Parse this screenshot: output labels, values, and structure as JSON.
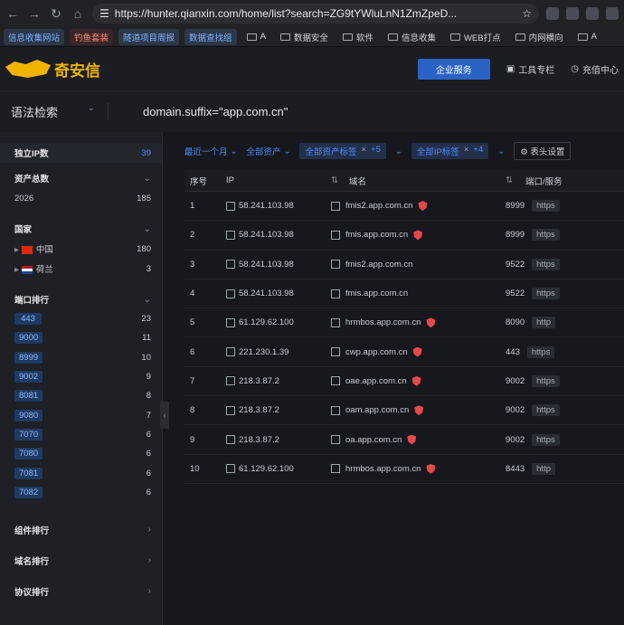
{
  "browser": {
    "url": "https://hunter.qianxin.com/home/list?search=ZG9tYWluLnN1ZmZpeD...",
    "bookmarks": [
      {
        "label": "信息收集网站",
        "style": "colored"
      },
      {
        "label": "钓鱼套装",
        "style": "red"
      },
      {
        "label": "隧道项目周报",
        "style": "colored"
      },
      {
        "label": "数据查找组",
        "style": "colored"
      },
      {
        "label": "A",
        "style": "folder"
      },
      {
        "label": "数据安全",
        "style": "folder"
      },
      {
        "label": "软件",
        "style": "folder"
      },
      {
        "label": "信息收集",
        "style": "folder"
      },
      {
        "label": "WEB打点",
        "style": "folder"
      },
      {
        "label": "内网横向",
        "style": "folder"
      },
      {
        "label": "A",
        "style": "folder"
      }
    ]
  },
  "header": {
    "logo_text": "奇安信",
    "enterprise": "企业服务",
    "tools": "工具专栏",
    "recharge": "充值中心"
  },
  "search": {
    "mode": "语法检索",
    "query": "domain.suffix=\"app.com.cn\""
  },
  "sidebar": {
    "unique_ip": {
      "label": "独立IP数",
      "value": "39"
    },
    "total_assets": {
      "label": "资产总数",
      "year": "2026",
      "count": "185"
    },
    "country": {
      "label": "国家",
      "items": [
        {
          "name": "中国",
          "count": "180",
          "flag": "cn"
        },
        {
          "name": "荷兰",
          "count": "3",
          "flag": "nl"
        }
      ]
    },
    "ports": {
      "label": "端口排行",
      "items": [
        {
          "port": "443",
          "count": "23"
        },
        {
          "port": "9000",
          "count": "11"
        },
        {
          "port": "8999",
          "count": "10"
        },
        {
          "port": "9002",
          "count": "9"
        },
        {
          "port": "8081",
          "count": "8"
        },
        {
          "port": "9080",
          "count": "7"
        },
        {
          "port": "7070",
          "count": "6"
        },
        {
          "port": "7080",
          "count": "6"
        },
        {
          "port": "7081",
          "count": "6"
        },
        {
          "port": "7082",
          "count": "6"
        }
      ]
    },
    "component_rank": "组件排行",
    "domain_rank": "域名排行",
    "protocol_rank": "协议排行"
  },
  "filters": {
    "last_month": "最近一个月",
    "all_assets": "全部资产",
    "asset_tags": "全部资产标签",
    "asset_tags_more": "+5",
    "ip_tags": "全部IP标签",
    "ip_tags_more": "+4",
    "column_settings": "表头设置"
  },
  "table": {
    "headers": {
      "no": "序号",
      "ip": "IP",
      "domain": "域名",
      "port": "端口/服务"
    },
    "rows": [
      {
        "no": "1",
        "ip": "58.241.103.98",
        "domain": "fmis2.app.com.cn",
        "shield": true,
        "port": "8999",
        "proto": "https"
      },
      {
        "no": "2",
        "ip": "58.241.103.98",
        "domain": "fmis.app.com.cn",
        "shield": true,
        "port": "8999",
        "proto": "https"
      },
      {
        "no": "3",
        "ip": "58.241.103.98",
        "domain": "fmis2.app.com.cn",
        "shield": false,
        "port": "9522",
        "proto": "https"
      },
      {
        "no": "4",
        "ip": "58.241.103.98",
        "domain": "fmis.app.com.cn",
        "shield": false,
        "port": "9522",
        "proto": "https"
      },
      {
        "no": "5",
        "ip": "61.129.62.100",
        "domain": "hrmbos.app.com.cn",
        "shield": true,
        "port": "8090",
        "proto": "http"
      },
      {
        "no": "6",
        "ip": "221.230.1.39",
        "domain": "cwp.app.com.cn",
        "shield": true,
        "port": "443",
        "proto": "https"
      },
      {
        "no": "7",
        "ip": "218.3.87.2",
        "domain": "oae.app.com.cn",
        "shield": true,
        "port": "9002",
        "proto": "https"
      },
      {
        "no": "8",
        "ip": "218.3.87.2",
        "domain": "oam.app.com.cn",
        "shield": true,
        "port": "9002",
        "proto": "https"
      },
      {
        "no": "9",
        "ip": "218.3.87.2",
        "domain": "oa.app.com.cn",
        "shield": true,
        "port": "9002",
        "proto": "https"
      },
      {
        "no": "10",
        "ip": "61.129.62.100",
        "domain": "hrmbos.app.com.cn",
        "shield": true,
        "port": "8443",
        "proto": "http"
      }
    ]
  }
}
